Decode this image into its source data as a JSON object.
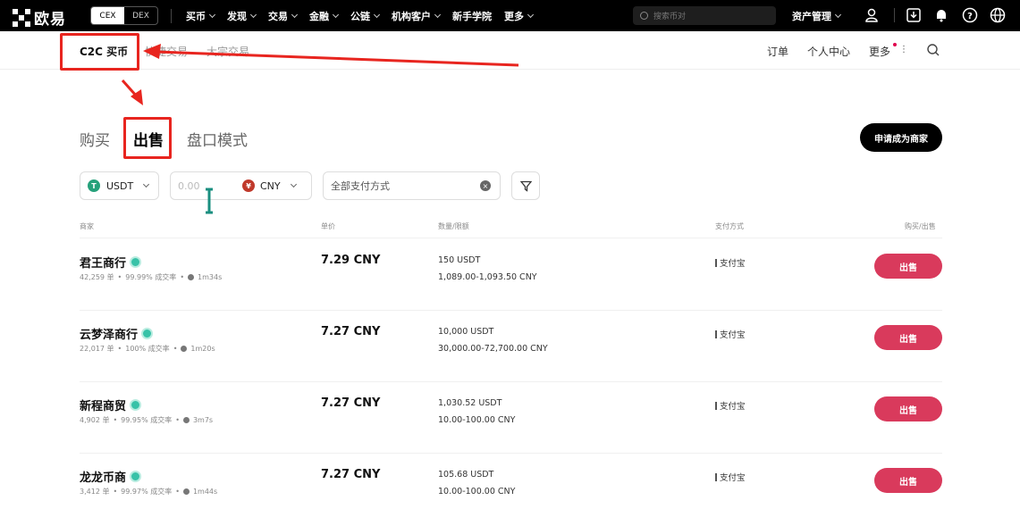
{
  "topbar": {
    "logo_text": "欧易",
    "toggle": [
      "CEX",
      "DEX"
    ],
    "nav": [
      "买币",
      "发现",
      "交易",
      "金融",
      "公链",
      "机构客户",
      "新手学院",
      "更多"
    ],
    "search_placeholder": "搜索币对",
    "asset_label": "资产管理"
  },
  "subnav": {
    "items": [
      "C2C 买币",
      "快捷交易",
      "大宗交易"
    ],
    "right": [
      "订单",
      "个人中心",
      "更多"
    ]
  },
  "tabs": {
    "buy": "购买",
    "sell": "出售",
    "orderbook": "盘口模式"
  },
  "merchant_button": "申请成为商家",
  "filters": {
    "coin": "USDT",
    "amount_placeholder": "0.00",
    "fiat": "CNY",
    "fiat_symbol": "¥",
    "payment": "全部支付方式"
  },
  "table": {
    "headers": {
      "merchant": "商家",
      "price": "单价",
      "qty": "数量/限额",
      "payment": "支付方式",
      "action": "购买/出售"
    },
    "rows": [
      {
        "name": "君王商行",
        "orders": "42,259 单",
        "rate": "99.99% 成交率",
        "time": "1m34s",
        "price": "7.29 CNY",
        "qty": "150 USDT",
        "limit": "1,089.00-1,093.50 CNY",
        "payment": "支付宝",
        "action": "出售"
      },
      {
        "name": "云梦泽商行",
        "orders": "22,017 单",
        "rate": "100% 成交率",
        "time": "1m20s",
        "price": "7.27 CNY",
        "qty": "10,000 USDT",
        "limit": "30,000.00-72,700.00 CNY",
        "payment": "支付宝",
        "action": "出售"
      },
      {
        "name": "新程商贸",
        "orders": "4,902 单",
        "rate": "99.95% 成交率",
        "time": "3m7s",
        "price": "7.27 CNY",
        "qty": "1,030.52 USDT",
        "limit": "10.00-100.00 CNY",
        "payment": "支付宝",
        "action": "出售"
      },
      {
        "name": "龙龙币商",
        "orders": "3,412 单",
        "rate": "99.97% 成交率",
        "time": "1m44s",
        "price": "7.27 CNY",
        "qty": "105.68 USDT",
        "limit": "10.00-100.00 CNY",
        "payment": "支付宝",
        "action": "出售"
      }
    ]
  },
  "colors": {
    "accent_red": "#d93a5c",
    "highlight": "#e8251f",
    "verify": "#38c2a8"
  }
}
